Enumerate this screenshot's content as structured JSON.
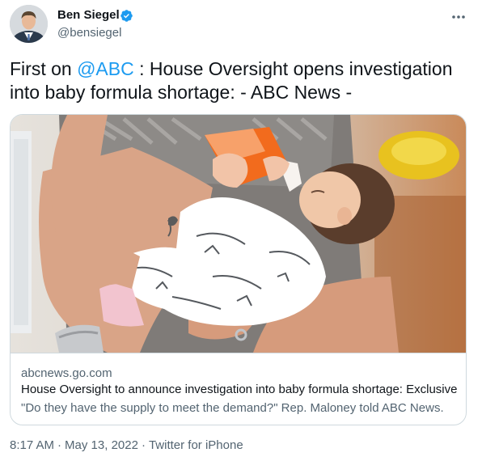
{
  "author": {
    "name": "Ben Siegel",
    "handle": "@bensiegel",
    "verified": true
  },
  "tweet": {
    "text_before": "First on ",
    "mention": "@ABC",
    "text_after": " : House Oversight opens investigation into baby formula shortage: - ABC News -"
  },
  "link_card": {
    "domain": "abcnews.go.com",
    "title": "House Oversight to announce investigation into baby formula shortage: Exclusive",
    "description": "\"Do they have the supply to meet the demand?\" Rep. Maloney told ABC News."
  },
  "meta": {
    "time": "8:17 AM",
    "date": "May 13, 2022",
    "separator": "·",
    "source": "Twitter for iPhone"
  },
  "icons": {
    "verified": "verified-badge-icon",
    "more": "more-horizontal-icon"
  },
  "colors": {
    "accent": "#1d9bf0",
    "text_primary": "#0f1419",
    "text_secondary": "#536471",
    "border": "#cfd9de",
    "bottle_orange": "#f26b1d"
  }
}
